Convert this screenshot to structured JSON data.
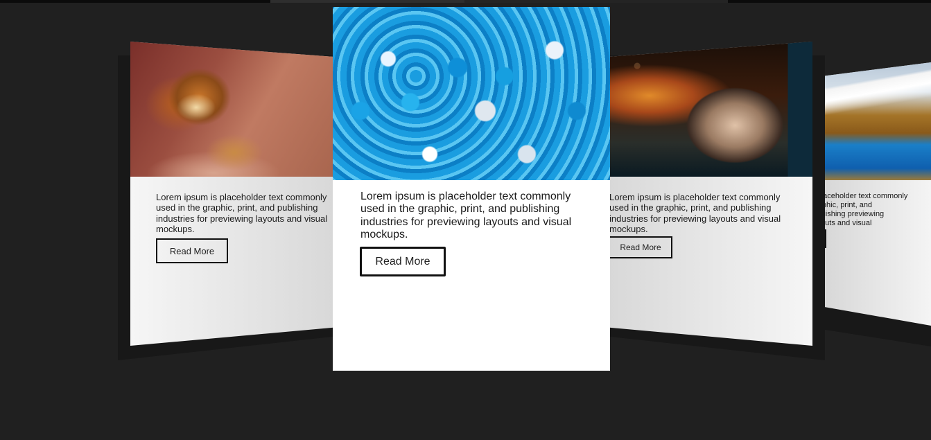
{
  "carousel": {
    "cards": [
      {
        "id": "lion",
        "image": "lion-photo",
        "text": "Lorem ipsum is placeholder text commonly used in the graphic, print, and publishing industries for previewing layouts and visual mockups.",
        "button_label": "Read More"
      },
      {
        "id": "pebbles",
        "image": "blue-pebbles-photo",
        "text": "Lorem ipsum is placeholder text commonly used in the graphic, print, and publishing industries for previewing layouts and visual mockups.",
        "button_label": "Read More"
      },
      {
        "id": "space",
        "image": "planet-space-photo",
        "text": "Lorem ipsum is placeholder text commonly used in the graphic, print, and publishing industries for previewing layouts and visual mockups.",
        "button_label": "Read More"
      },
      {
        "id": "mountain",
        "image": "mountain-lake-photo",
        "text": "s placeholder text commonly graphic, print, and publishing previewing layouts and visual",
        "button_label": "re"
      }
    ]
  },
  "colors": {
    "background": "#202020",
    "card": "#ffffff",
    "button_border": "#111111"
  }
}
